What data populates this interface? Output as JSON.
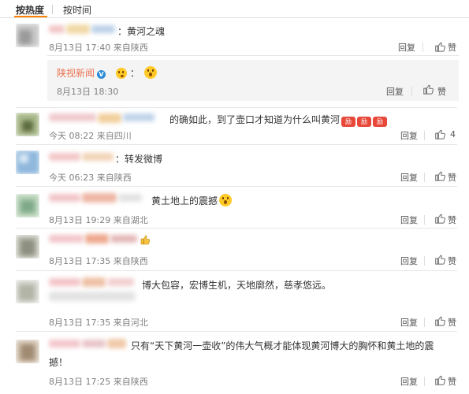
{
  "tabs": {
    "hot": "按热度",
    "time": "按时间"
  },
  "actions": {
    "reply": "回复",
    "like_icon": "thumbs-up-icon"
  },
  "colors": {
    "accent": "#ff8200",
    "username": "#eb7350",
    "meta": "#808080"
  },
  "comments": [
    {
      "text": "：黄河之魂",
      "date": "8月13日 17:40",
      "from": "来自陕西",
      "likes": ""
    },
    {
      "text": "的确如此，到了壶口才知道为什么叫黄河",
      "date": "今天 08:22",
      "from": "来自四川",
      "likes": "4"
    },
    {
      "text": "：转发微博",
      "date": "今天 06:23",
      "from": "来自陕西",
      "likes": ""
    },
    {
      "text": "黄土地上的震撼",
      "date": "8月13日 19:29",
      "from": "来自湖北",
      "likes": ""
    },
    {
      "text": "",
      "date": "8月13日 17:35",
      "from": "来自陕西",
      "likes": ""
    },
    {
      "text": "博大包容，宏博生机，天地廓然，慈孝悠远。",
      "date": "8月13日 17:35",
      "from": "来自河北",
      "likes": ""
    },
    {
      "text_line1": "只有“天下黄河一壶收”的伟大气概才能体现黄河博大的胸怀和黄土地的震",
      "text_line2": "撼！",
      "date": "8月13日 17:25",
      "from": "来自陕西",
      "likes": ""
    }
  ],
  "nested_reply": {
    "user": "陕视新闻",
    "date": "8月13日 18:30",
    "from": ""
  }
}
